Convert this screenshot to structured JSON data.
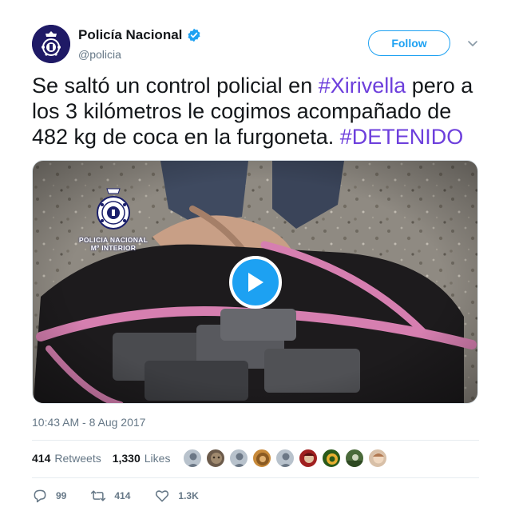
{
  "account": {
    "name": "Policía Nacional",
    "handle": "@policia",
    "verified": true,
    "follow_label": "Follow"
  },
  "tweet": {
    "text_1": "Se saltó un control policial en ",
    "hashtag_1": "#Xirivella",
    "text_2": " pero a los 3 kilómetros le cogimos acompañado de 482 kg de coca en la furgoneta. ",
    "hashtag_2": "#DETENIDO",
    "timestamp": "10:43 AM - 8 Aug 2017"
  },
  "media": {
    "type": "video",
    "watermark_line1": "POLICIA NACIONAL",
    "watermark_line2": "Mº INTERIOR",
    "play_icon": "play-icon"
  },
  "stats": {
    "retweets_count": "414",
    "retweets_label": "Retweets",
    "likes_count": "1,330",
    "likes_label": "Likes",
    "liker_avatars": 9
  },
  "actions": {
    "reply_count": "99",
    "retweet_count": "414",
    "like_count": "1.3K"
  },
  "colors": {
    "brand_blue": "#1da1f2",
    "hashtag": "#6d3fdc",
    "muted": "#657786"
  }
}
